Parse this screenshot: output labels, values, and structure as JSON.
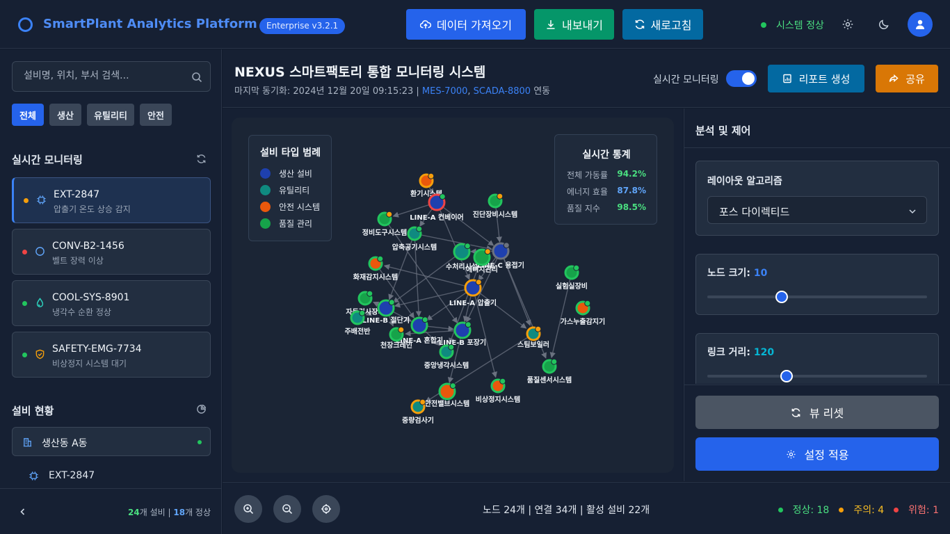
{
  "header": {
    "app_title": "SmartPlant Analytics Platform",
    "version_badge": "Enterprise v3.2.1",
    "import_label": "데이터 가져오기",
    "export_label": "내보내기",
    "refresh_label": "새로고침",
    "system_status": "시스템 정상",
    "colors": {
      "import": "#2563eb",
      "export": "#059669",
      "refresh": "#0369a1"
    }
  },
  "sidebar": {
    "search_placeholder": "설비명, 위치, 부서 검색...",
    "filters": [
      "전체",
      "생산",
      "유틸리티",
      "안전"
    ],
    "monitoring_title": "실시간 모니터링",
    "alerts": [
      {
        "name": "EXT-2847",
        "desc": "압출기 온도 상승 감지",
        "status_color": "#f59e0b",
        "icon": "chip-icon"
      },
      {
        "name": "CONV-B2-1456",
        "desc": "벨트 장력 이상",
        "status_color": "#ef4444",
        "icon": "circle-icon"
      },
      {
        "name": "COOL-SYS-8901",
        "desc": "냉각수 순환 정상",
        "status_color": "#22c55e",
        "icon": "droplet-icon"
      },
      {
        "name": "SAFETY-EMG-7734",
        "desc": "비상정지 시스템 대기",
        "status_color": "#22c55e",
        "icon": "shield-icon"
      }
    ],
    "equipment_title": "설비 현황",
    "facility": "생산동 A동",
    "facility_item": "EXT-2847",
    "footer_count": "24",
    "footer_count_unit": "개 설비",
    "footer_normal": "18",
    "footer_normal_unit": "개 정상"
  },
  "main": {
    "title": "NEXUS 스마트팩토리 통합 모니터링 시스템",
    "sync_prefix": "마지막 동기화: 2024년 12월 20일 09:15:23",
    "sync_sep": "|",
    "mes": "MES-7000",
    "comma": ",",
    "scada": "SCADA-8800",
    "sync_suffix": "연동",
    "realtime_label": "실시간 모니터링",
    "realtime_on": true,
    "report_label": "리포트 생성",
    "share_label": "공유"
  },
  "legend": {
    "title": "설비 타입 범례",
    "items": [
      {
        "label": "생산 설비",
        "color": "#1e40af"
      },
      {
        "label": "유틸리티",
        "color": "#0f8a80"
      },
      {
        "label": "안전 시스템",
        "color": "#ea580c"
      },
      {
        "label": "품질 관리",
        "color": "#16a34a"
      }
    ]
  },
  "stats": {
    "title": "실시간 통계",
    "rows": [
      {
        "label": "전체 가동률",
        "value": "94.2%",
        "color": "#4ade80"
      },
      {
        "label": "에너지 효율",
        "value": "87.8%",
        "color": "#60a5fa"
      },
      {
        "label": "품질 지수",
        "value": "98.5%",
        "color": "#4ade80"
      }
    ]
  },
  "graph": {
    "nodes": [
      {
        "id": "환기시스템",
        "type": "safety",
        "ring": "#f59e0b",
        "badge": "#f59e0b"
      },
      {
        "id": "LINE-A 컨베이어",
        "type": "production",
        "ring": "#ef4444",
        "badge": "#22c55e"
      },
      {
        "id": "진단장비시스템",
        "type": "quality",
        "ring": "#22c55e",
        "badge": "#f59e0b"
      },
      {
        "id": "정비도구시스템",
        "type": "quality",
        "ring": "#22c55e",
        "badge": "#f59e0b"
      },
      {
        "id": "압축공기시스템",
        "type": "utility",
        "ring": "#22c55e",
        "badge": "#22c55e"
      },
      {
        "id": "LINE-C 용접기",
        "type": "production",
        "ring": "#6b7280",
        "badge": "#6b7280"
      },
      {
        "id": "수처리시설",
        "type": "utility",
        "ring": "#22c55e",
        "badge": "#22c55e"
      },
      {
        "id": "에너지관리",
        "type": "quality",
        "ring": "#22c55e",
        "badge": "#f59e0b"
      },
      {
        "id": "화재감지시스템",
        "type": "safety",
        "ring": "#22c55e",
        "badge": "#22c55e"
      },
      {
        "id": "LINE-A 압출기",
        "type": "production",
        "ring": "#f59e0b",
        "badge": "#f59e0b"
      },
      {
        "id": "실험실장비",
        "type": "quality",
        "ring": "#22c55e",
        "badge": "#22c55e"
      },
      {
        "id": "자동검사장비",
        "type": "quality",
        "ring": "#22c55e",
        "badge": "#22c55e"
      },
      {
        "id": "LINE-B 절단기",
        "type": "production",
        "ring": "#22c55e",
        "badge": "#22c55e"
      },
      {
        "id": "주배전반",
        "type": "utility",
        "ring": "#22c55e",
        "badge": "#22c55e"
      },
      {
        "id": "가스누출감지기",
        "type": "safety",
        "ring": "#22c55e",
        "badge": "#22c55e"
      },
      {
        "id": "LINE-A 혼합기",
        "type": "production",
        "ring": "#22c55e",
        "badge": "#22c55e"
      },
      {
        "id": "LINE-B 포장기",
        "type": "production",
        "ring": "#22c55e",
        "badge": "#22c55e"
      },
      {
        "id": "천장크레인",
        "type": "quality",
        "ring": "#22c55e",
        "badge": "#f59e0b"
      },
      {
        "id": "중앙냉각시스템",
        "type": "utility",
        "ring": "#22c55e",
        "badge": "#22c55e"
      },
      {
        "id": "스팀보일러",
        "type": "utility",
        "ring": "#f59e0b",
        "badge": "#f59e0b"
      },
      {
        "id": "품질센서시스템",
        "type": "quality",
        "ring": "#22c55e",
        "badge": "#22c55e"
      },
      {
        "id": "안전밸브시스템",
        "type": "safety",
        "ring": "#22c55e",
        "badge": "#22c55e"
      },
      {
        "id": "비상정지시스템",
        "type": "safety",
        "ring": "#22c55e",
        "badge": "#22c55e"
      },
      {
        "id": "중량검사기",
        "type": "utility",
        "ring": "#f59e0b",
        "badge": "#f59e0b"
      }
    ],
    "links": [
      [
        "환기시스템",
        "LINE-A 컨베이어"
      ],
      [
        "LINE-A 컨베이어",
        "LINE-C 용접기"
      ],
      [
        "LINE-A 컨베이어",
        "LINE-A 압출기"
      ],
      [
        "LINE-A 컨베이어",
        "정비도구시스템"
      ],
      [
        "LINE-A 컨베이어",
        "압축공기시스템"
      ],
      [
        "진단장비시스템",
        "LINE-C 용접기"
      ],
      [
        "압축공기시스템",
        "LINE-C 용접기"
      ],
      [
        "압축공기시스템",
        "LINE-B 절단기"
      ],
      [
        "압축공기시스템",
        "LINE-A 혼합기"
      ],
      [
        "LINE-C 용접기",
        "LINE-A 압출기"
      ],
      [
        "LINE-C 용접기",
        "수처리시설"
      ],
      [
        "LINE-C 용접기",
        "스팀보일러"
      ],
      [
        "LINE-C 용접기",
        "품질센서시스템"
      ],
      [
        "LINE-C 용접기",
        "LINE-B 포장기"
      ],
      [
        "LINE-A 압출기",
        "LINE-B 절단기"
      ],
      [
        "LINE-A 압출기",
        "LINE-A 혼합기"
      ],
      [
        "LINE-A 압출기",
        "LINE-B 포장기"
      ],
      [
        "LINE-A 압출기",
        "화재감지시스템"
      ],
      [
        "LINE-A 압출기",
        "스팀보일러"
      ],
      [
        "LINE-A 압출기",
        "비상정지시스템"
      ],
      [
        "LINE-B 절단기",
        "LINE-A 혼합기"
      ],
      [
        "LINE-B 절단기",
        "자동검사장비"
      ],
      [
        "LINE-B 절단기",
        "주배전반"
      ],
      [
        "LINE-B 절단기",
        "천장크레인"
      ],
      [
        "LINE-A 혼합기",
        "LINE-B 포장기"
      ],
      [
        "LINE-A 혼합기",
        "중앙냉각시스템"
      ],
      [
        "LINE-B 포장기",
        "천장크레인"
      ],
      [
        "LINE-B 포장기",
        "안전밸브시스템"
      ],
      [
        "화재감지시스템",
        "LINE-A 혼합기"
      ],
      [
        "정비도구시스템",
        "LINE-B 포장기"
      ],
      [
        "수처리시설",
        "LINE-B 절단기"
      ],
      [
        "스팀보일러",
        "중량검사기"
      ],
      [
        "실험실장비",
        "품질센서시스템"
      ],
      [
        "에너지관리",
        "중앙냉각시스템"
      ]
    ]
  },
  "panel": {
    "title": "분석 및 제어",
    "layout_label": "레이아웃 알고리즘",
    "layout_value": "포스 다이렉티드",
    "node_size_label": "노드 크기:",
    "node_size_value": "10",
    "node_size_fraction": 0.34,
    "link_distance_label": "링크 거리:",
    "link_distance_value": "120",
    "link_distance_fraction": 0.36,
    "reset_label": "뷰 리셋",
    "apply_label": "설정 적용"
  },
  "footer": {
    "node_count": "노드 24개",
    "link_count": "연결 34개",
    "active_count": "활성 설비 22개",
    "sep": "|",
    "normal": "정상: 18",
    "warn": "주의: 4",
    "danger": "위험: 1"
  }
}
